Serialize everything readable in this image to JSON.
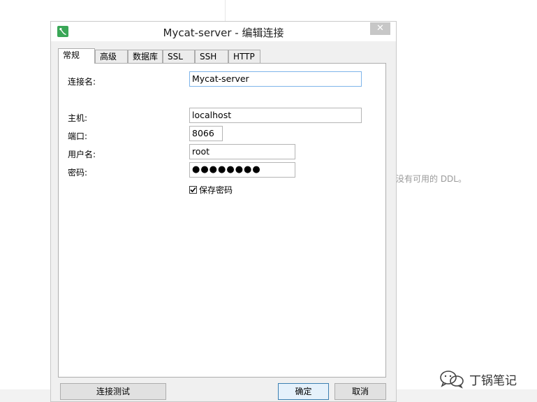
{
  "window": {
    "title": "Mycat-server - 编辑连接",
    "close_glyph": "✕"
  },
  "tabs": [
    {
      "label": "常规",
      "active": true
    },
    {
      "label": "高级",
      "active": false
    },
    {
      "label": "数据库",
      "active": false
    },
    {
      "label": "SSL",
      "active": false
    },
    {
      "label": "SSH",
      "active": false
    },
    {
      "label": "HTTP",
      "active": false
    }
  ],
  "form": {
    "connection_name": {
      "label": "连接名:",
      "value": "Mycat-server"
    },
    "host": {
      "label": "主机:",
      "value": "localhost"
    },
    "port": {
      "label": "端口:",
      "value": "8066"
    },
    "username": {
      "label": "用户名:",
      "value": "root"
    },
    "password": {
      "label": "密码:",
      "value": "●●●●●●●●"
    },
    "save_password": {
      "label": "保存密码",
      "checked": true
    }
  },
  "buttons": {
    "test_connection": "连接测试",
    "ok": "确定",
    "cancel": "取消"
  },
  "background": {
    "ddl_message": "没有可用的 DDL。"
  },
  "watermark": {
    "text": "丁锅笔记"
  },
  "colors": {
    "app_icon": "#3aa757",
    "close_button": "#c7c7c7",
    "focus_border": "#7eb4ea",
    "primary_border": "#3c7fb1"
  }
}
